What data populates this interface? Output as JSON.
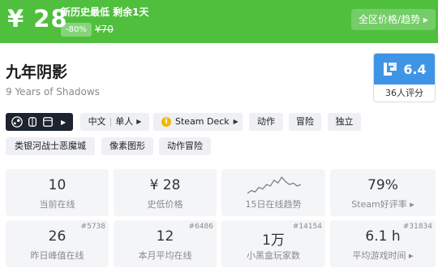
{
  "banner": {
    "price": "¥ 28",
    "headline": "新历史最低 剩余1天",
    "discount": "-80%",
    "original_price": "¥70",
    "region_button": "全区价格/趋势 ▸",
    "color": "#4fbf3d"
  },
  "game": {
    "title": "九年阴影",
    "subtitle": "9 Years of Shadows"
  },
  "score": {
    "value": "6.4",
    "count_label": "36人评分",
    "icon": "rating-logo-icon",
    "color": "#3f94e6"
  },
  "tags": {
    "platform_icons": [
      "steam-icon",
      "controller-icon",
      "window-icon"
    ],
    "language": "中文",
    "players": "单人",
    "steam_deck": "Steam Deck",
    "genres": [
      "动作",
      "冒险",
      "独立"
    ],
    "row2": [
      "类银河战士恶魔城",
      "像素图形",
      "动作冒险"
    ]
  },
  "stats": [
    {
      "value": "10",
      "label": "当前在线"
    },
    {
      "value": "¥ 28",
      "label": "史低价格"
    },
    {
      "value": "",
      "label": "15日在线趋势"
    },
    {
      "value": "79%",
      "label": "Steam好评率 ▸"
    },
    {
      "value": "26",
      "label": "昨日峰值在线",
      "rank": "#5738"
    },
    {
      "value": "12",
      "label": "本月平均在线",
      "rank": "#6486"
    },
    {
      "value": "1万",
      "label": "小黑盒玩家数",
      "rank": "#14154"
    },
    {
      "value": "6.1 h",
      "label": "平均游戏时间 ▸",
      "rank": "#31834"
    }
  ],
  "trend_data": [
    3,
    5,
    4,
    7,
    6,
    9,
    8,
    12,
    10,
    14,
    11,
    9,
    10,
    8,
    9
  ]
}
